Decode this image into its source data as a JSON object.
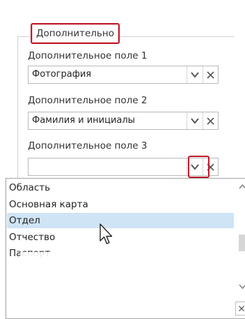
{
  "group": {
    "title": "Дополнительно"
  },
  "fields": [
    {
      "label": "Дополнительное поле 1",
      "value": "Фотография"
    },
    {
      "label": "Дополнительное поле 2",
      "value": "Фамилия и инициалы"
    },
    {
      "label": "Дополнительное поле 3",
      "value": ""
    }
  ],
  "dropdown": {
    "items": [
      {
        "label": "Область"
      },
      {
        "label": "Основная карта"
      },
      {
        "label": "Отдел",
        "selected": true
      },
      {
        "label": "Отчество"
      },
      {
        "label": "Паспорт"
      }
    ]
  },
  "colors": {
    "highlight": "#c0182a",
    "selected_row": "#cfe4f5"
  },
  "icons": {
    "arrow": "chevron-down-icon",
    "clear": "close-icon",
    "cursor": "mouse-pointer-icon"
  }
}
